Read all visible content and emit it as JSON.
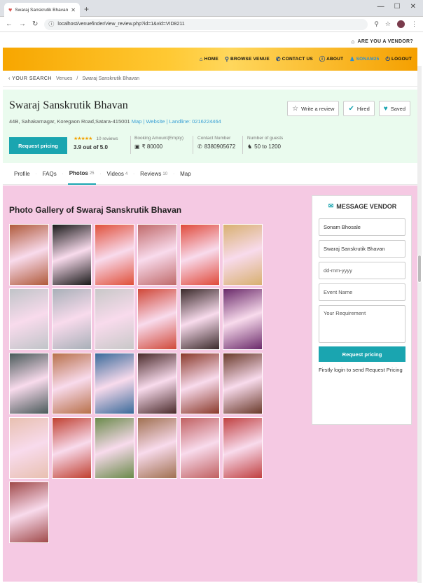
{
  "browser": {
    "tab_title": "Swaraj Sanskrutik Bhavan",
    "url": "localhost/venuefinder/view_review.php?id=1&vid=VID8211"
  },
  "topbar": {
    "vendor_link": "ARE YOU A VENDOR?"
  },
  "nav": {
    "items": [
      {
        "label": "HOME",
        "icon": "home-icon"
      },
      {
        "label": "BROWSE VENUE",
        "icon": "map-pin-icon"
      },
      {
        "label": "CONTACT US",
        "icon": "phone-icon"
      },
      {
        "label": "ABOUT",
        "icon": "info-icon"
      },
      {
        "label": "SONAM25",
        "icon": "user-icon"
      },
      {
        "label": "LOGOUT",
        "icon": "power-icon"
      }
    ]
  },
  "breadcrumb": {
    "back": "YOUR SEARCH",
    "crumb1": "Venues",
    "sep": "/",
    "crumb2": "Swaraj Sanskrutik Bhavan"
  },
  "venue": {
    "name": "Swaraj Sanskrutik Bhavan",
    "address": "44B, Sahakarnagar, Koregaon Road,Satara-415001",
    "map_link": "Map",
    "website_link": "Website",
    "landline": "Landline: 0216224464",
    "sep": "|"
  },
  "actions": {
    "write_review": "Write a review",
    "hired": "Hired",
    "saved": "Saved"
  },
  "request_pricing": "Request pricing",
  "stats": {
    "reviews_count": "10 reviews",
    "rating_text": "3.9 out of 5.0",
    "stars": "★★★★★",
    "booking_label": "Booking Amount(Empty)",
    "booking_value": "₹ 80000",
    "contact_label": "Contact Number",
    "contact_value": "8380905672",
    "guests_label": "Number of guests",
    "guests_value": "50 to 1200"
  },
  "tabs": [
    {
      "label": "Profile",
      "count": ""
    },
    {
      "label": "FAQs",
      "count": ""
    },
    {
      "label": "Photos",
      "count": "25"
    },
    {
      "label": "Videos",
      "count": "4"
    },
    {
      "label": "Reviews",
      "count": "10"
    },
    {
      "label": "Map",
      "count": ""
    }
  ],
  "gallery": {
    "title": "Photo Gallery of Swaraj Sanskrutik Bhavan",
    "photos": [
      "#b05a3a",
      "#1a1a1a",
      "#e0503a",
      "#c06a6a",
      "#e04a3a",
      "#d8b070",
      "#c0c4c8",
      "#a8b0b8",
      "#c8c8c8",
      "#d04838",
      "#3a2a2a",
      "#6a2a6a",
      "#4a5a5a",
      "#b8704a",
      "#3a6a9a",
      "#4a2a2a",
      "#8a3a2a",
      "#6a3a2a",
      "#e8c0b0",
      "#c04030",
      "#6a8a4a",
      "#a07050",
      "#c06060",
      "#c04040",
      "#a04a4a"
    ]
  },
  "message_vendor": {
    "title": "MESSAGE VENDOR",
    "name_value": "Sonam Bhosale",
    "venue_value": "Swaraj Sanskrutik Bhavan",
    "date_placeholder": "dd-mm-yyyy",
    "event_placeholder": "Event Name",
    "requirement_placeholder": "Your Requirement",
    "button": "Request pricing",
    "note": "Firstly login to send Request Pricing"
  }
}
